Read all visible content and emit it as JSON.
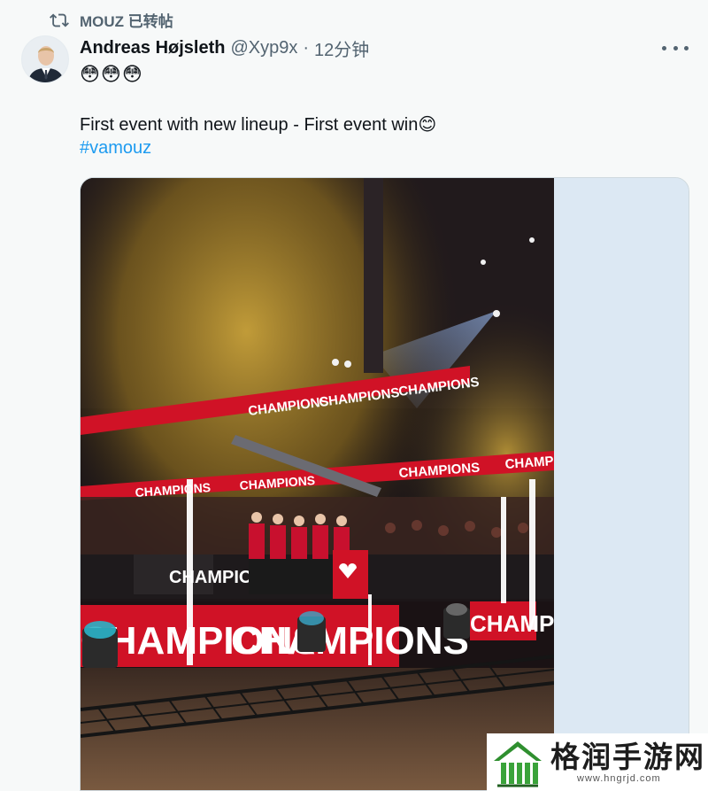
{
  "repost": {
    "label": "MOUZ 已转帖"
  },
  "tweet": {
    "author_name": "Andreas Højsleth",
    "handle": "@Xyp9x",
    "separator": "·",
    "timestamp": "12分钟",
    "emoji_line": "😳😳😳",
    "text": "First event with new lineup - First event win😊",
    "hashtag": "#vamouz"
  },
  "media": {
    "banner_text": "CHAMPIONS"
  },
  "watermark": {
    "title": "格润手游网",
    "url": "www.hngrjd.com"
  },
  "colors": {
    "accent": "#1d9bf0",
    "muted": "#536471",
    "banner_red": "#e0142b"
  },
  "icons": [
    "repost-icon",
    "more-icon",
    "avatar-image",
    "watermark-logo-icon"
  ]
}
